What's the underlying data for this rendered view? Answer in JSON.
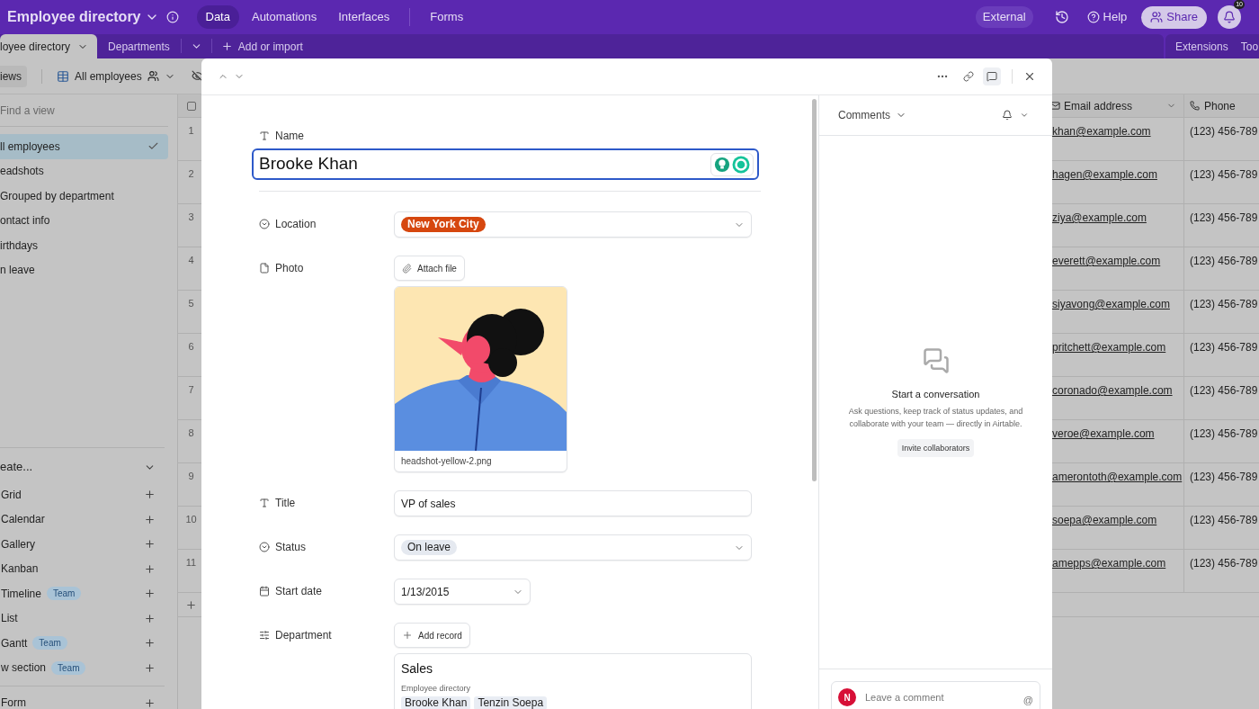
{
  "app": {
    "title": "Employee directory",
    "nav": [
      {
        "label": "Data",
        "selected": true
      },
      {
        "label": "Automations",
        "selected": false
      },
      {
        "label": "Interfaces",
        "selected": false
      },
      {
        "label": "Forms",
        "selected": false
      }
    ],
    "external": "External",
    "help": "Help",
    "share": "Share",
    "notifications": "10"
  },
  "table_tabs": {
    "tabs": [
      {
        "label": "loyee directory",
        "selected": true
      },
      {
        "label": "Departments",
        "selected": false
      }
    ],
    "add": "Add or import",
    "right": [
      "Extensions",
      "Too"
    ]
  },
  "view_bar": {
    "views_button": "iews",
    "current_view": "All employees"
  },
  "sidebar": {
    "search_placeholder": "Find a view",
    "views": [
      {
        "label": "ll employees",
        "selected": true
      },
      {
        "label": "eadshots",
        "selected": false
      },
      {
        "label": "Grouped by department",
        "selected": false
      },
      {
        "label": "ontact info",
        "selected": false
      },
      {
        "label": "irthdays",
        "selected": false
      },
      {
        "label": "n leave",
        "selected": false
      }
    ],
    "create_heading": "eate...",
    "create_items": [
      {
        "label": "Grid"
      },
      {
        "label": "Calendar"
      },
      {
        "label": "Gallery"
      },
      {
        "label": "Kanban"
      },
      {
        "label": "Timeline",
        "badge": "Team"
      },
      {
        "label": "List"
      },
      {
        "label": "Gantt",
        "badge": "Team"
      },
      {
        "label": "w section",
        "badge": "Team"
      }
    ],
    "form_item": {
      "label": "Form"
    }
  },
  "grid": {
    "all_selected": false,
    "columns": [
      {
        "label": "Email address"
      },
      {
        "label": "Phone"
      }
    ],
    "rows": [
      {
        "number": "1",
        "email": "khan@example.com",
        "phone": "(123) 456-789"
      },
      {
        "number": "2",
        "email": "hagen@example.com",
        "phone": "(123) 456-789"
      },
      {
        "number": "3",
        "email": "ziya@example.com",
        "phone": "(123) 456-789"
      },
      {
        "number": "4",
        "email": "everett@example.com",
        "phone": "(123) 456-789"
      },
      {
        "number": "5",
        "email": "siyavong@example.com",
        "phone": "(123) 456-789"
      },
      {
        "number": "6",
        "email": "pritchett@example.com",
        "phone": "(123) 456-789"
      },
      {
        "number": "7",
        "email": "coronado@example.com",
        "phone": "(123) 456-789"
      },
      {
        "number": "8",
        "email": "veroe@example.com",
        "phone": "(123) 456-789"
      },
      {
        "number": "9",
        "email": "amerontoth@example.com",
        "phone": "(123) 456-789"
      },
      {
        "number": "10",
        "email": "soepa@example.com",
        "phone": "(123) 456-789"
      },
      {
        "number": "11",
        "email": "amepps@example.com",
        "phone": "(123) 456-789"
      }
    ]
  },
  "record": {
    "comments_open": true,
    "name": {
      "label": "Name",
      "value": "Brooke Khan"
    },
    "fields": [
      {
        "kind": "select",
        "label": "Location",
        "choice": {
          "label": "New York City",
          "color": "#d6470f"
        }
      },
      {
        "kind": "attachment",
        "label": "Photo",
        "button": "Attach file",
        "file": "headshot-yellow-2.png"
      },
      {
        "kind": "text",
        "label": "Title",
        "value": "VP of sales"
      },
      {
        "kind": "select",
        "label": "Status",
        "choice": {
          "label": "On leave",
          "color": "#e5e9f0"
        }
      },
      {
        "kind": "date",
        "label": "Start date",
        "value": "1/13/2015"
      },
      {
        "kind": "link",
        "label": "Department",
        "button": "Add record",
        "record": {
          "title": "Sales",
          "subtitle": "Employee directory",
          "chips": [
            "Brooke Khan",
            "Tenzin Soepa"
          ]
        }
      }
    ]
  },
  "comments": {
    "title": "Comments",
    "empty_title": "Start a conversation",
    "empty_text": "Ask questions, keep track of status updates, and collaborate with your team — directly in Airtable.",
    "invite": "Invite collaborators",
    "avatar": "N",
    "placeholder": "Leave a comment",
    "mention": "@"
  }
}
